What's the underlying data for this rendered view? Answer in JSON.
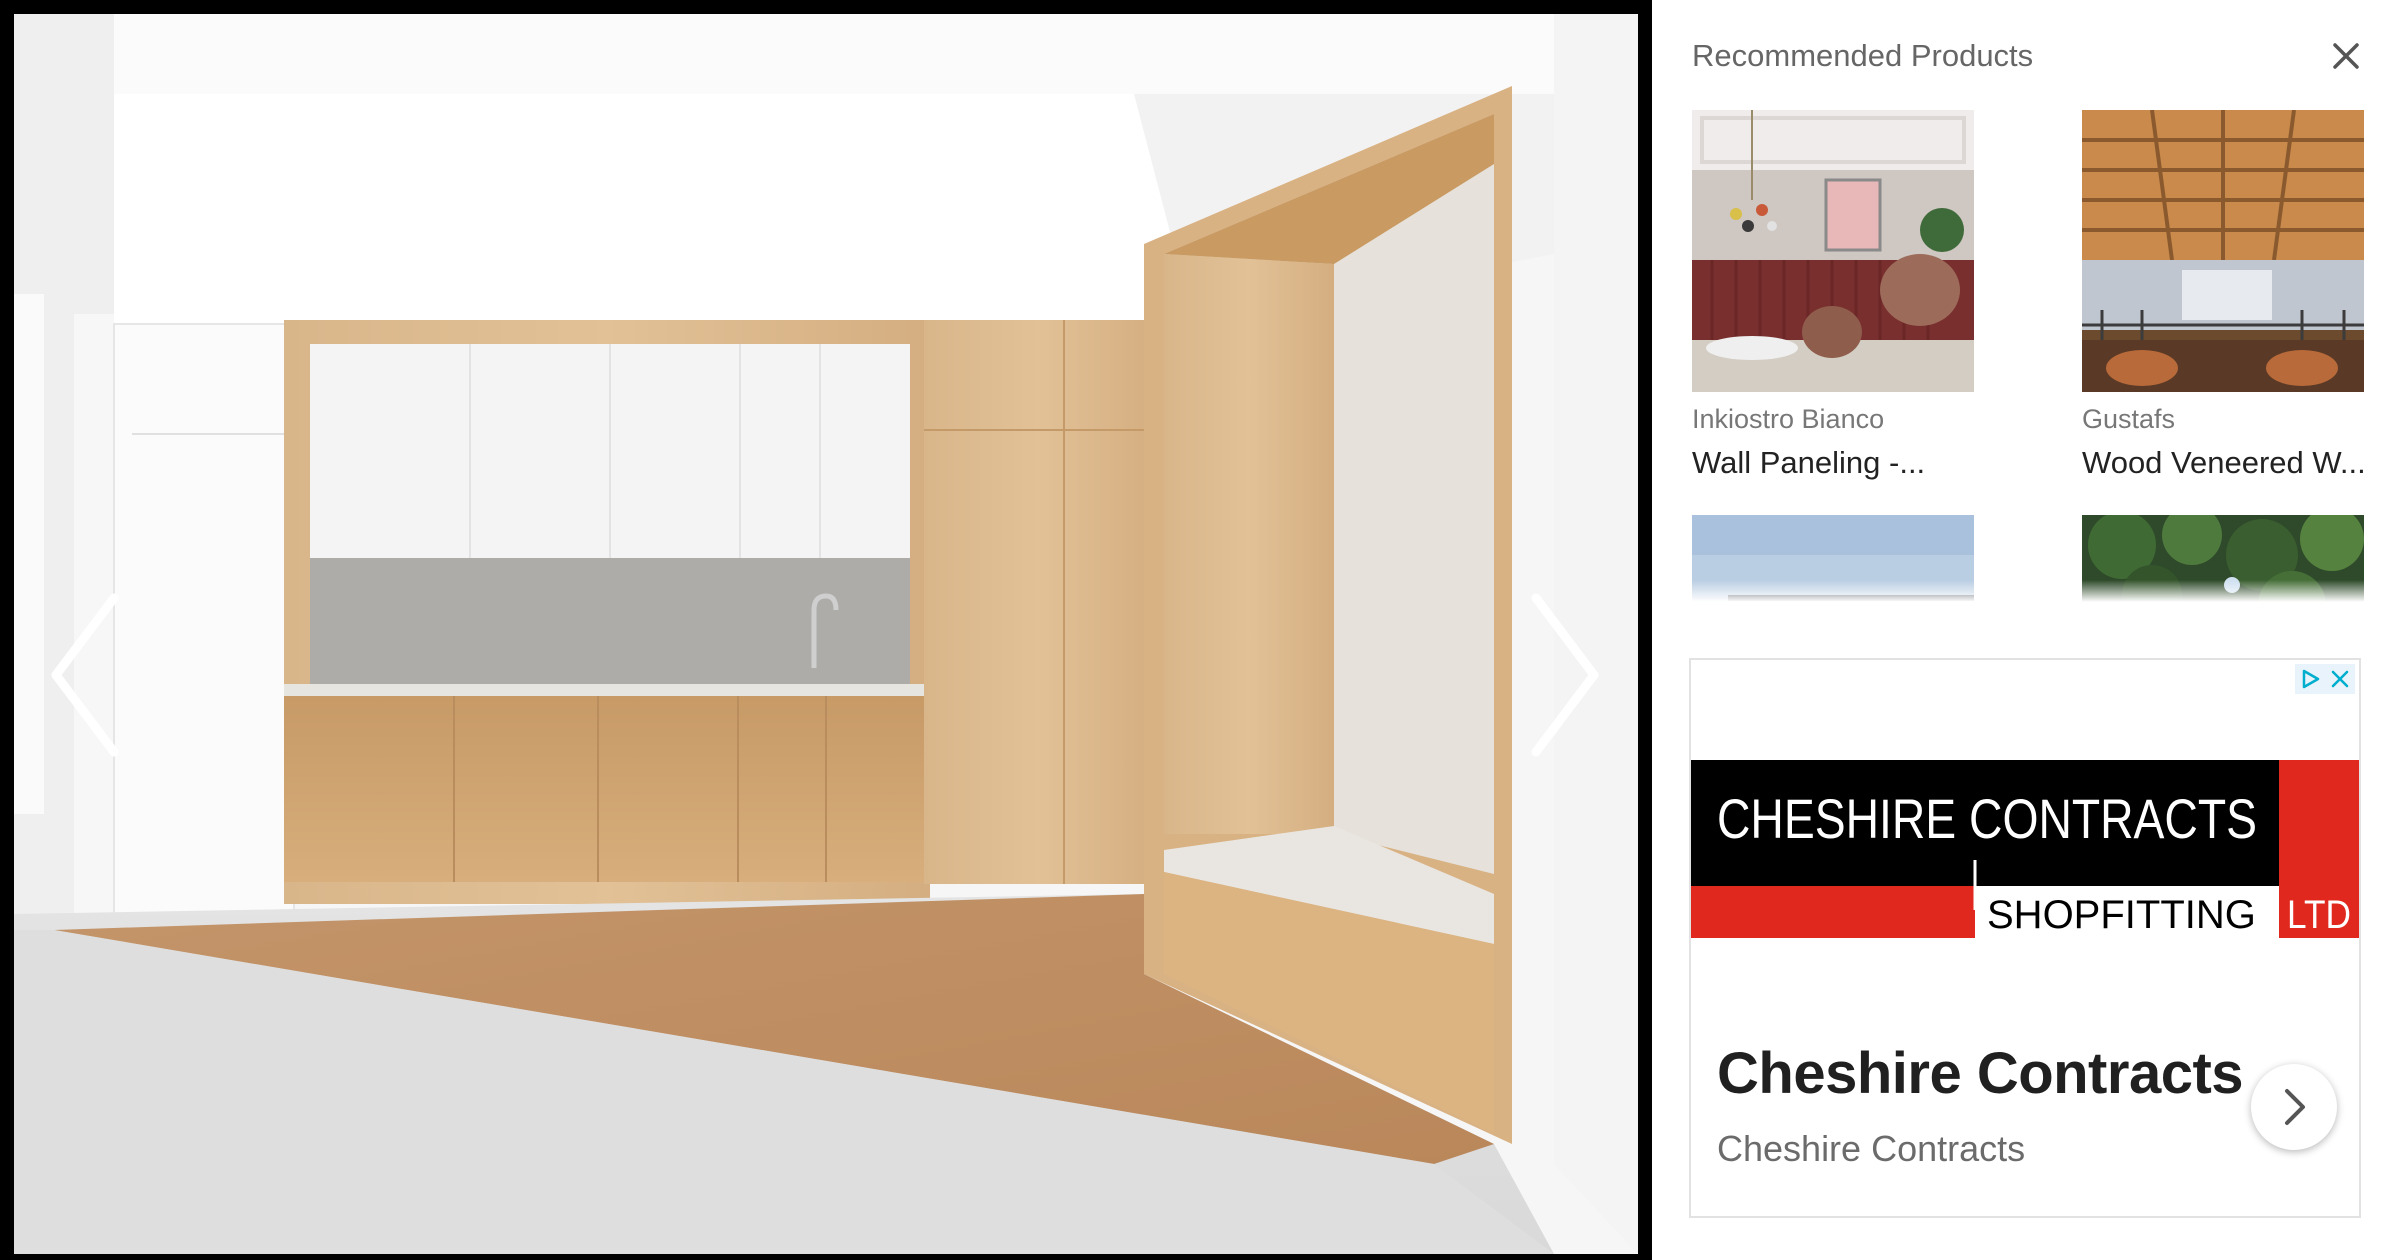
{
  "gallery": {
    "photo_icon": "kitchen-interior-photo",
    "prev_icon": "chevron-left-icon",
    "next_icon": "chevron-right-icon"
  },
  "recommended": {
    "title": "Recommended Products",
    "close_icon": "close-icon",
    "products": [
      {
        "brand": "Inkiostro Bianco",
        "name": "Wall Paneling -..."
      },
      {
        "brand": "Gustafs",
        "name": "Wood Veneered W..."
      },
      {
        "brand": "",
        "name": ""
      },
      {
        "brand": "",
        "name": ""
      }
    ]
  },
  "ad": {
    "choices_icon": "adchoices-icon",
    "banner": {
      "line1": "CHESHIRE CONTRACTS",
      "line2": "SHOPFITTING",
      "line2_suffix": "LTD"
    },
    "headline": "Cheshire Contracts",
    "advertiser": "Cheshire Contracts",
    "cta_icon": "chevron-right-icon",
    "colors": {
      "banner_black": "#000000",
      "banner_red": "#e0281e"
    }
  }
}
